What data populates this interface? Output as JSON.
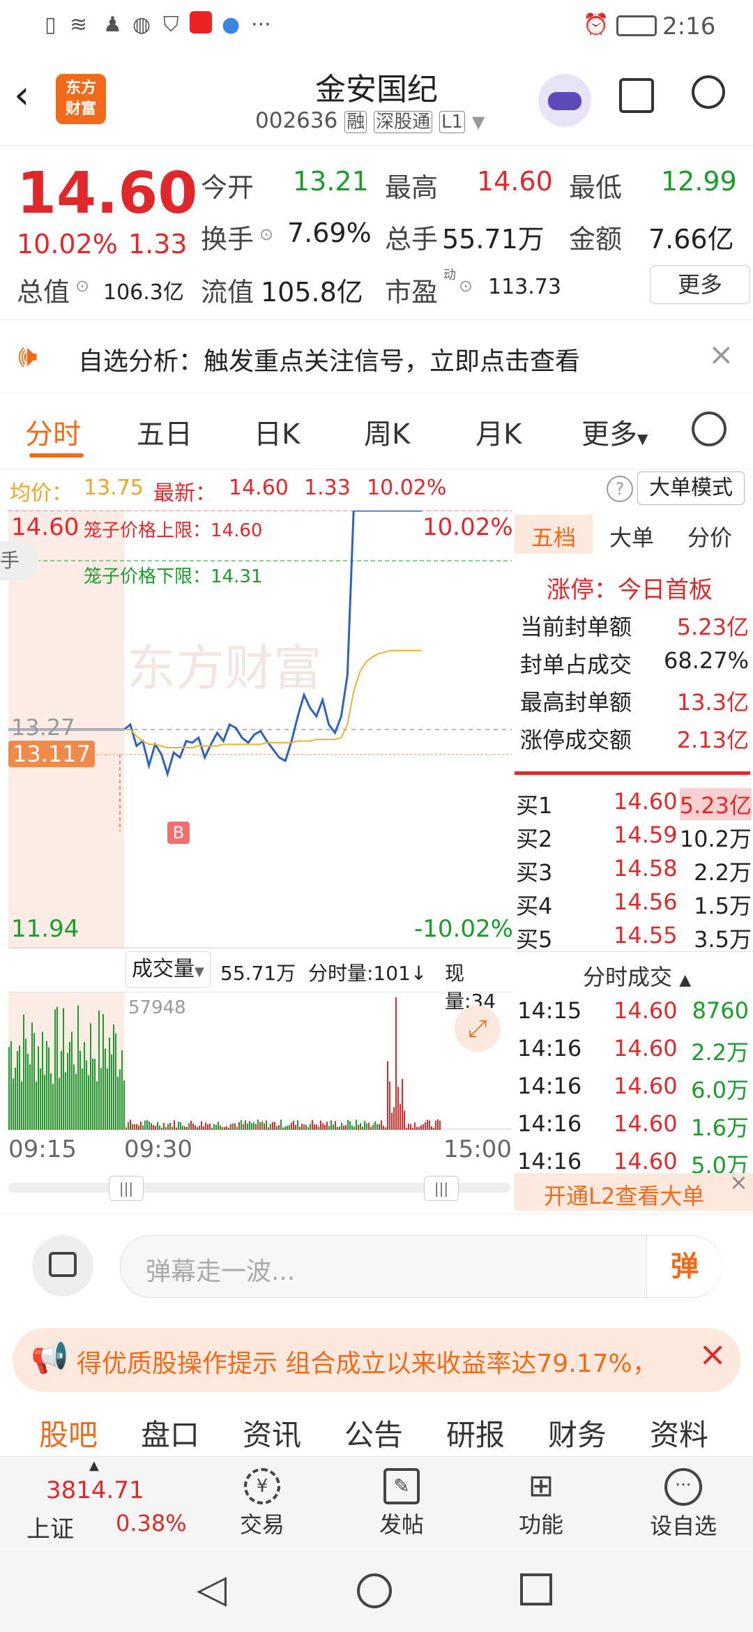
{
  "status_bar": {
    "time": "2:16",
    "icons": [
      "sim-alert-icon",
      "wifi-icon",
      "qq-icon",
      "wechat-icon",
      "shield-icon",
      "app-icon",
      "browser-icon",
      "more-dots-icon"
    ]
  },
  "header": {
    "title": "金安国纪",
    "code": "002636",
    "tags": [
      "融",
      "深股通",
      "L1"
    ],
    "logo_text_1": "东方",
    "logo_text_2": "财富"
  },
  "quote": {
    "price": "14.60",
    "change_pct": "10.02%",
    "change": "1.33",
    "open_label": "今开",
    "open": "13.21",
    "high_label": "最高",
    "high": "14.60",
    "low_label": "最低",
    "low": "12.99",
    "turnover_label": "换手",
    "turnover": "7.69%",
    "volume_label": "总手",
    "volume": "55.71万",
    "amount_label": "金额",
    "amount": "7.66亿",
    "mktcap_label": "总值",
    "mktcap": "106.3亿",
    "float_label": "流值",
    "float": "105.8亿",
    "pe_label": "市盈",
    "pe_super": "动",
    "pe": "113.73",
    "more_label": "更多"
  },
  "notice": {
    "text": "自选分析：触发重点关注信号，立即点击查看"
  },
  "tabs": {
    "items": [
      "分时",
      "五日",
      "日K",
      "周K",
      "月K",
      "更多"
    ],
    "active": 0
  },
  "infoline": {
    "avg_label": "均价：",
    "avg": "13.75",
    "latest_label": "最新：",
    "latest": "14.60",
    "change": "1.33",
    "pct": "10.02%",
    "mode_button": "大单模式"
  },
  "chart": {
    "top_price": "14.60",
    "top_pct": "10.02%",
    "bottom_price": "11.94",
    "bottom_pct": "-10.02%",
    "prev_close": "13.27",
    "cursor_price": "13.117",
    "cage_upper_label": "笼子价格上限：",
    "cage_upper": "14.60",
    "cage_lower_label": "笼子价格下限：",
    "cage_lower": "14.31",
    "marker": "B",
    "watermark": "东方财富",
    "side_tab": "手"
  },
  "chart_data": {
    "type": "line",
    "ylim": [
      11.94,
      14.6
    ],
    "prev_close": 13.27,
    "series": [
      {
        "name": "",
        "values": [
          13.27,
          13.27,
          13.27,
          13.27,
          13.27,
          13.3,
          13.17,
          13.2,
          13.05,
          13.18,
          13.12,
          13.0,
          13.13,
          13.1,
          13.2,
          13.19,
          13.22,
          13.1,
          13.18,
          13.25,
          13.2,
          13.3,
          13.28,
          13.22,
          13.19,
          13.24,
          13.26,
          13.2,
          13.15,
          13.1,
          13.08,
          13.2,
          13.35,
          13.48,
          13.4,
          13.35,
          13.45,
          13.3,
          13.25,
          13.35,
          13.6,
          14.6,
          14.6,
          14.6,
          14.6,
          14.6,
          14.6,
          14.6,
          14.6,
          14.6,
          14.6,
          14.6,
          14.6
        ]
      },
      {
        "name": "",
        "values": [
          13.27,
          13.27,
          13.27,
          13.27,
          13.27,
          13.27,
          13.23,
          13.2,
          13.18,
          13.18,
          13.17,
          13.16,
          13.16,
          13.16,
          13.16,
          13.16,
          13.17,
          13.17,
          13.17,
          13.17,
          13.18,
          13.18,
          13.18,
          13.18,
          13.18,
          13.18,
          13.18,
          13.19,
          13.19,
          13.19,
          13.19,
          13.19,
          13.2,
          13.2,
          13.2,
          13.21,
          13.21,
          13.21,
          13.21,
          13.22,
          13.3,
          13.5,
          13.62,
          13.68,
          13.71,
          13.73,
          13.74,
          13.75,
          13.75,
          13.75,
          13.75,
          13.75,
          13.75
        ]
      }
    ]
  },
  "right_panel": {
    "tabs": [
      "五档",
      "大单",
      "分价"
    ],
    "limit_title": "涨停：今日首板",
    "stats": [
      {
        "label": "当前封单额",
        "value": "5.23亿"
      },
      {
        "label": "封单占成交",
        "value": "68.27%"
      },
      {
        "label": "最高封单额",
        "value": "13.3亿"
      },
      {
        "label": "涨停成交额",
        "value": "2.13亿"
      }
    ],
    "bids": [
      {
        "label": "买1",
        "price": "14.60",
        "vol": "5.23亿"
      },
      {
        "label": "买2",
        "price": "14.59",
        "vol": "10.2万"
      },
      {
        "label": "买3",
        "price": "14.58",
        "vol": "2.2万"
      },
      {
        "label": "买4",
        "price": "14.56",
        "vol": "1.5万"
      },
      {
        "label": "买5",
        "price": "14.55",
        "vol": "3.5万"
      }
    ],
    "ticks_title": "分时成交",
    "ticks": [
      {
        "time": "14:15",
        "price": "14.60",
        "vol": "8760"
      },
      {
        "time": "14:16",
        "price": "14.60",
        "vol": "2.2万"
      },
      {
        "time": "14:16",
        "price": "14.60",
        "vol": "6.0万"
      },
      {
        "time": "14:16",
        "price": "14.60",
        "vol": "1.6万"
      },
      {
        "time": "14:16",
        "price": "14.60",
        "vol": "5.0万"
      }
    ],
    "l2_label": "开通L2查看大单"
  },
  "volume": {
    "label": "成交量",
    "total": "55.71万",
    "minute_label": "分时量:101",
    "now_label": "现量:34",
    "peak": "57948",
    "times": [
      "09:15",
      "09:30",
      "15:00"
    ]
  },
  "comment": {
    "placeholder": "弹幕走一波...",
    "button": "弹"
  },
  "banner": {
    "text": "得优质股操作提示 组合成立以来收益率达79.17%，"
  },
  "bottom_tabs": [
    "股吧",
    "盘口",
    "资讯",
    "公告",
    "研报",
    "财务",
    "资料"
  ],
  "bottom_nav": {
    "index_value": "3814.71",
    "index_name": "上证",
    "index_pct": "0.38%",
    "items": [
      "交易",
      "发帖",
      "功能",
      "设自选"
    ]
  },
  "colors": {
    "up": "#e0282b",
    "down": "#1a9c2c",
    "accent": "#f06a1a",
    "line": "#2f62b8",
    "avg": "#e8b436"
  }
}
